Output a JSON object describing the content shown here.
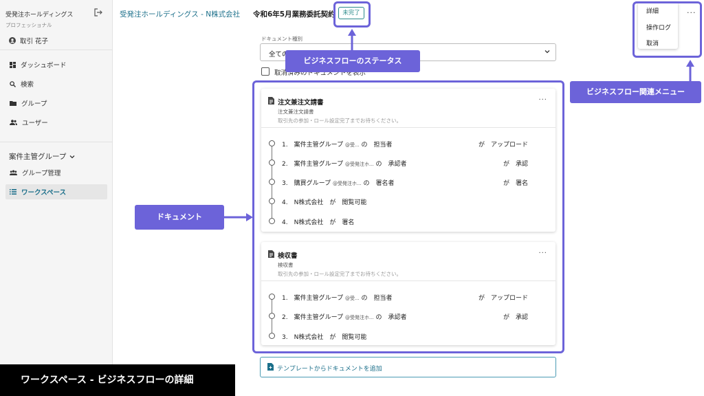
{
  "sidebar": {
    "org_name": "受発注ホールディングス",
    "plan": "プロフェッショナル",
    "user": "取引 花子",
    "items": [
      {
        "label": "ダッシュボード"
      },
      {
        "label": "検索"
      },
      {
        "label": "グループ"
      },
      {
        "label": "ユーザー"
      }
    ],
    "group_heading": "案件主管グループ",
    "group_items": [
      {
        "label": "グループ管理"
      },
      {
        "label": "ワークスペース"
      }
    ]
  },
  "header": {
    "breadcrumb": "受発注ホールディングス - N株式会社",
    "contract_title": "令和6年5月業務委託契約",
    "status": "未完了"
  },
  "menu": {
    "items": [
      {
        "label": "詳細"
      },
      {
        "label": "操作ログ"
      },
      {
        "label": "取消"
      }
    ]
  },
  "filter": {
    "label": "ドキュメント種別",
    "value": "全ての",
    "checkbox_label": "取消済みのドキュメントを表示"
  },
  "documents": [
    {
      "title": "注文兼注文請書",
      "subtitle": "注文兼注文請書",
      "note": "取引先の参加・ロール設定完了までお待ちください。",
      "steps": [
        {
          "num": "1.",
          "text": "案件主管グループ",
          "small": "@受...",
          "suffix": "の　担当者",
          "right": "が　アップロード"
        },
        {
          "num": "2.",
          "text": "案件主管グループ",
          "small": "@受発注ホ...",
          "suffix": "の　承認者",
          "right": "が　承認"
        },
        {
          "num": "3.",
          "text": "購買グループ",
          "small": "@受発注ホ...",
          "suffix": "の　署名者",
          "right": "が　署名"
        },
        {
          "num": "4.",
          "text": "N株式会社　が　閲覧可能",
          "small": "",
          "suffix": "",
          "right": ""
        },
        {
          "num": "4.",
          "text": "N株式会社　が　署名",
          "small": "",
          "suffix": "",
          "right": ""
        }
      ]
    },
    {
      "title": "検収書",
      "subtitle": "検収書",
      "note": "取引先の参加・ロール設定完了までお待ちください。",
      "steps": [
        {
          "num": "1.",
          "text": "案件主管グループ",
          "small": "@受...",
          "suffix": "の　担当者",
          "right": "が　アップロード"
        },
        {
          "num": "2.",
          "text": "案件主管グループ",
          "small": "@受発注ホ...",
          "suffix": "の　承認者",
          "right": "が　承認"
        },
        {
          "num": "3.",
          "text": "N株式会社　が　閲覧可能",
          "small": "",
          "suffix": "",
          "right": ""
        }
      ]
    }
  ],
  "add_document": "テンプレートからドキュメントを追加",
  "annotations": {
    "status": "ビジネスフローのステータス",
    "menu": "ビジネスフロー関連メニュー",
    "documents": "ドキュメント"
  },
  "caption": "ワークスペース - ビジネスフローの詳細",
  "colors": {
    "annotation": "#6c63d9",
    "accent": "#1b6f8a",
    "status": "#2b8a8a"
  }
}
